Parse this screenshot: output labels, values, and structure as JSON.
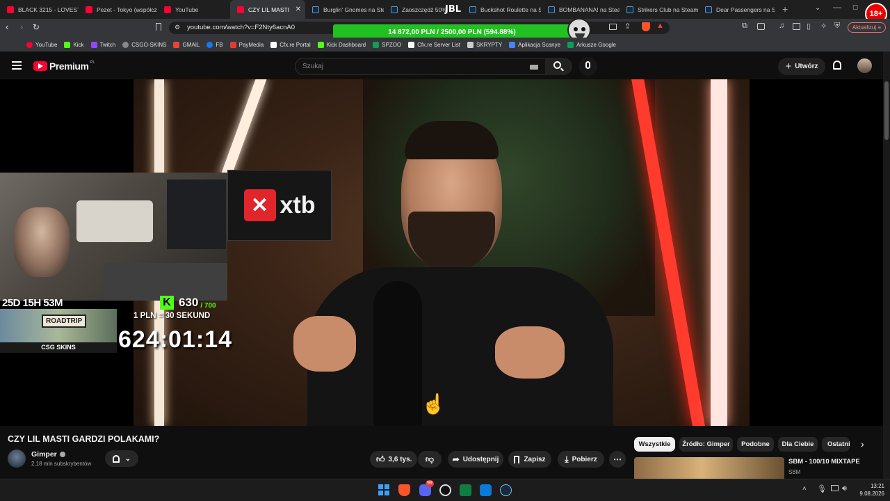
{
  "tabs": [
    {
      "title": "BLACK 3215 - LOVESTORY",
      "favicon": "youtube-icon"
    },
    {
      "title": "Pezet - Tokyo (współczesne)",
      "favicon": "youtube-icon"
    },
    {
      "title": "YouTube",
      "favicon": "youtube-icon"
    },
    {
      "title": "CZY LIL MASTI",
      "favicon": "youtube-icon",
      "active": true
    },
    {
      "title": "Burglin' Gnomes na Steam",
      "favicon": "steam-icon"
    },
    {
      "title": "Zaoszczędź 50%",
      "favicon": "steam-icon"
    },
    {
      "title": "Buckshot Roulette na Steam",
      "favicon": "steam-icon"
    },
    {
      "title": "BOMBANANA! na Steam",
      "favicon": "steam-icon"
    },
    {
      "title": "Strikers Club na Steam",
      "favicon": "steam-icon"
    },
    {
      "title": "Dear Passengers na Steam",
      "favicon": "steam-icon"
    }
  ],
  "browser": {
    "url": "youtube.com/watch?v=F2Nty6acnA0",
    "update_button": "Aktualizuj",
    "overlay_banner": "14 872,00 PLN / 2500,00 PLN  (594.88%)",
    "overlay_logo": "JBL",
    "age_badge": "18+"
  },
  "bookmarks": [
    "YouTube",
    "Kick",
    "Twitch",
    "CSGO-SKINS",
    "GMAIL",
    "FB",
    "PayMedia",
    "Cfx.re Portal",
    "Kick Dashboard",
    "SPZOO",
    "Cfx.re Server List",
    "SKRYPTY",
    "Aplikacja Scanye",
    "Arkusze Google"
  ],
  "youtube": {
    "logo_text": "Premium",
    "logo_region": "PL",
    "search_placeholder": "Szukaj",
    "create_label": "Utwórz"
  },
  "video": {
    "sponsor_logo": "xtb",
    "stream_timer": "25D 15H 53M",
    "kick_count": "630",
    "kick_goal": "/ 700",
    "roadtrip_label": "ROADTRIP",
    "csgo_label": "CSG SKINS",
    "subathon_rate": "1 PLN = 30 SEKUND",
    "subathon_clock": "624:01:14"
  },
  "watch": {
    "title": "CZY LIL MASTI GARDZI POLAKAMI?",
    "channel": "Gimper",
    "subscribers": "2,18 mln subskrybentów",
    "likes": "3,6 tys.",
    "share_label": "Udostępnij",
    "save_label": "Zapisz",
    "download_label": "Pobierz"
  },
  "filter_chips": [
    "Wszystkie",
    "Źródło: Gimper",
    "Podobne",
    "Dla Ciebie",
    "Ostatnio"
  ],
  "recommendation": {
    "title": "SBM - 100/10 MIXTAPE",
    "channel": "SBM"
  },
  "taskbar": {
    "time": "13:21",
    "date": "9.08.2026",
    "discord_badge": "99"
  },
  "colors": {
    "yt_red": "#ff0033",
    "kick_green": "#53fc18",
    "banner_green": "#22c122"
  }
}
